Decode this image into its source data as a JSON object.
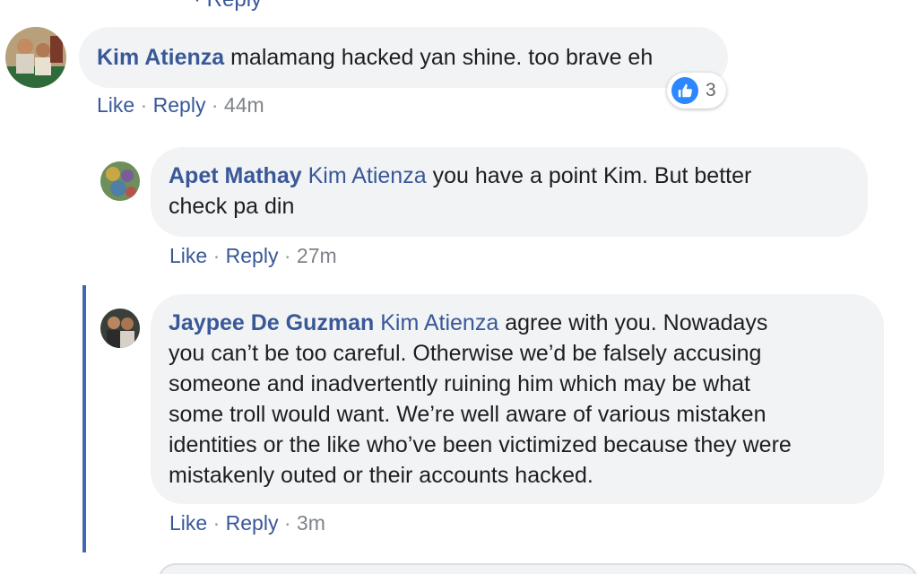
{
  "top_fragment": "· Reply",
  "comments": [
    {
      "author": "Kim Atienza",
      "text": "malamang hacked yan shine. too brave eh",
      "actions": {
        "like": "Like",
        "sep": "·",
        "reply": "Reply",
        "time": "44m"
      },
      "reactions": {
        "icon": "thumbs-up-icon",
        "count": "3",
        "color": "#2d88ff"
      }
    },
    {
      "author": "Apet Mathay",
      "mention": "Kim Atienza",
      "text_line1": "you have a point Kim. But better",
      "text_line2": "check pa din",
      "actions": {
        "like": "Like",
        "sep": "·",
        "reply": "Reply",
        "time": "27m"
      }
    },
    {
      "author": "Jaypee De Guzman",
      "mention": "Kim Atienza",
      "text_line1": "agree with you. Nowadays",
      "lines": [
        "you can’t be too careful. Otherwise we’d be falsely accusing",
        "someone and inadvertently ruining him which may be what",
        "some troll would want. We’re well aware of various mistaken",
        "identities or the like who’ve been victimized because they were",
        "mistakenly outed or their accounts hacked."
      ],
      "actions": {
        "like": "Like",
        "sep": "·",
        "reply": "Reply",
        "time": "3m"
      }
    }
  ],
  "colors": {
    "link_blue": "#385898",
    "bubble_bg": "#f2f3f5",
    "thread_line": "#4267b2"
  }
}
